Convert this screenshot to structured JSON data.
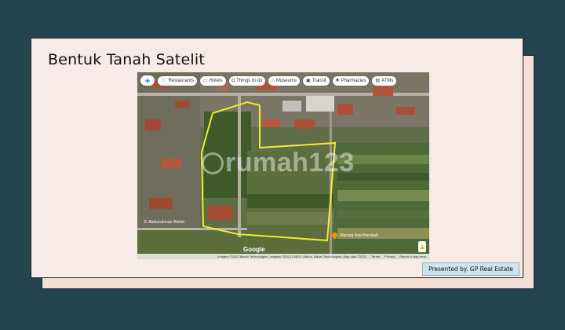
{
  "slide": {
    "title": "Bentuk Tanah Satelit",
    "presented_by": "Presented by. GP Real Estate"
  },
  "map": {
    "nav_icon": "directions-icon",
    "categories": [
      {
        "label": "Restaurants",
        "icon": "fork-knife-icon"
      },
      {
        "label": "Hotels",
        "icon": "bed-icon"
      },
      {
        "label": "Things to do",
        "icon": "camera-icon"
      },
      {
        "label": "Museums",
        "icon": "museum-icon"
      },
      {
        "label": "Transit",
        "icon": "train-icon"
      },
      {
        "label": "Pharmacies",
        "icon": "pharmacy-icon"
      },
      {
        "label": "ATMs",
        "icon": "atm-icon"
      }
    ],
    "watermark": "rumah123",
    "brand": "Google",
    "place_label_1": "Warung Kopi Barokah",
    "place_label_2": "Jl. Abdurrahman Wahid",
    "attribution": "Imagery ©2022 Maxar Technologies, Imagery ©2022 CNES / Airbus, Maxar Technologies, Map data ©2022",
    "terms": "Terms",
    "privacy": "Privacy",
    "report": "Report a map error",
    "boundary_color": "#f2ea2c"
  }
}
